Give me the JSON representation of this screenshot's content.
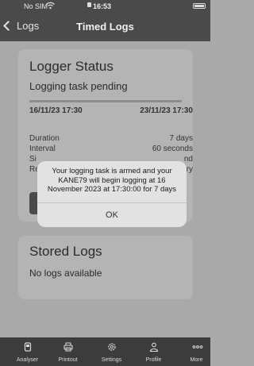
{
  "status_bar": {
    "carrier": "No SIM",
    "time": "16:53"
  },
  "nav": {
    "back_label": "Logs",
    "title": "Timed Logs"
  },
  "logger_status": {
    "heading": "Logger Status",
    "state": "Logging task pending",
    "progress_fraction": 0.0,
    "start": "16/11/23 17:30",
    "end": "23/11/23 17:30",
    "rows": [
      {
        "key": "Duration",
        "value": "7 days"
      },
      {
        "key": "Interval",
        "value": "60 seconds"
      },
      {
        "key": "Si",
        "value": "nd"
      },
      {
        "key": "Re",
        "value": "ry"
      }
    ]
  },
  "stored_logs": {
    "heading": "Stored Logs",
    "empty_text": "No logs available"
  },
  "alert": {
    "message": "Your logging task is armed and your KANE79 will begin logging at 16 November 2023 at 17:30:00 for 7 days",
    "ok_label": "OK"
  },
  "tabbar": {
    "items": [
      {
        "label": "Analyser",
        "icon": "analyser-icon"
      },
      {
        "label": "Printout",
        "icon": "printer-icon"
      },
      {
        "label": "Settings",
        "icon": "gear-icon"
      },
      {
        "label": "Profile",
        "icon": "person-icon"
      },
      {
        "label": "More",
        "icon": "more-dots-icon"
      }
    ]
  }
}
